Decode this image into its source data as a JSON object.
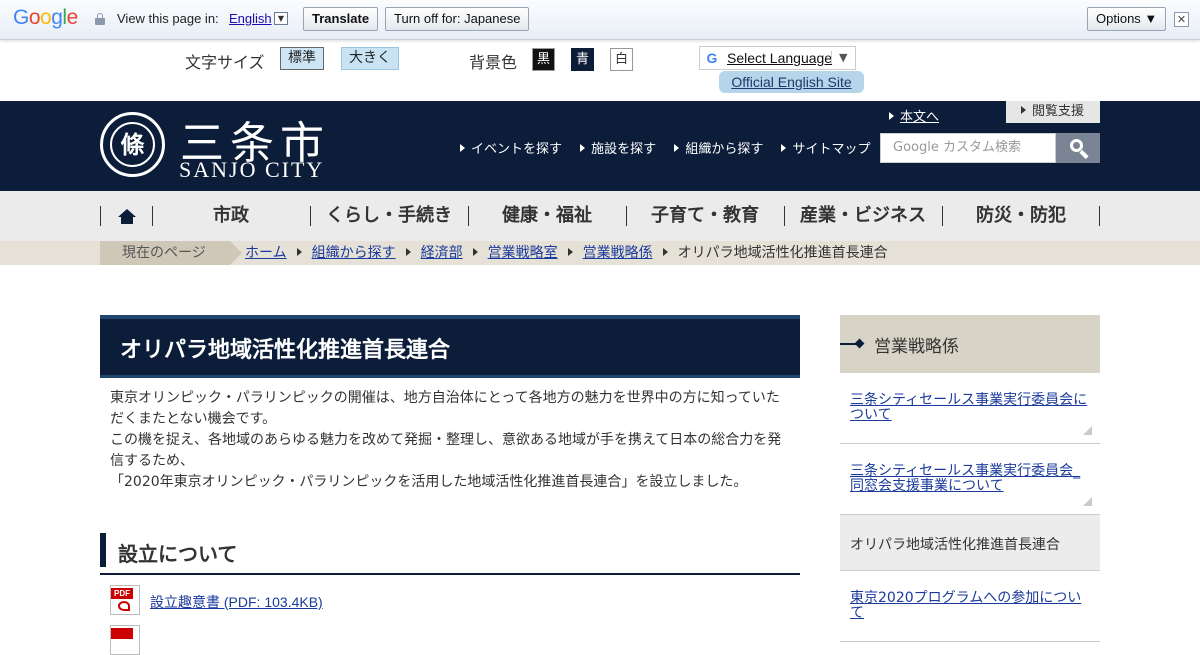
{
  "google_bar": {
    "logo_letters": [
      {
        "ch": "G",
        "color": "#4285f4"
      },
      {
        "ch": "o",
        "color": "#ea4335"
      },
      {
        "ch": "o",
        "color": "#fbbc05"
      },
      {
        "ch": "g",
        "color": "#4285f4"
      },
      {
        "ch": "l",
        "color": "#34a853"
      },
      {
        "ch": "e",
        "color": "#ea4335"
      }
    ],
    "view_text": "View this page in:",
    "language": "English",
    "translate_label": "Translate",
    "turn_off_label": "Turn off for: Japanese",
    "options_label": "Options ▼",
    "close_glyph": "✕"
  },
  "utility": {
    "font_size_label": "文字サイズ",
    "font_normal": "標準",
    "font_large": "大きく",
    "bg_label": "背景色",
    "bg_black": "黒",
    "bg_blue": "青",
    "bg_white": "白",
    "select_language": "Select Language",
    "select_arrow": "▼",
    "google_g": "G",
    "english_site": "Official English Site"
  },
  "header": {
    "emblem_glyph": "條",
    "city_jp": "三条市",
    "city_en": "SANJO CITY",
    "skip_link": "本文へ",
    "reading_support": "閲覧支援",
    "links": [
      "イベントを探す",
      "施設を探す",
      "組織から探す",
      "サイトマップ"
    ],
    "search_placeholder": "Google カスタム検索"
  },
  "nav": {
    "items": [
      "市政",
      "くらし・手続き",
      "健康・福祉",
      "子育て・教育",
      "産業・ビジネス",
      "防災・防犯"
    ]
  },
  "breadcrumb": {
    "current_label": "現在のページ",
    "items": [
      "ホーム",
      "組織から探す",
      "経済部",
      "営業戦略室",
      "営業戦略係"
    ],
    "current": "オリパラ地域活性化推進首長連合"
  },
  "main": {
    "title": "オリパラ地域活性化推進首長連合",
    "intro": [
      "東京オリンピック・パラリンピックの開催は、地方自治体にとって各地方の魅力を世界中の方に知っていただくまたとない機会です。",
      "この機を捉え、各地域のあらゆる魅力を改めて発掘・整理し、意欲ある地域が手を携えて日本の総合力を発信するため、",
      "「2020年東京オリンピック・パラリンピックを活用した地域活性化推進首長連合」を設立しました。"
    ],
    "section_title": "設立について",
    "pdf_label": "PDF",
    "files": [
      {
        "label": "設立趣意書 (PDF: 103.4KB)"
      }
    ]
  },
  "side": {
    "heading": "営業戦略係",
    "items": [
      {
        "label": "三条シティセールス事業実行委員会について",
        "current": false
      },
      {
        "label": "三条シティセールス事業実行委員会_同窓会支援事業について",
        "current": false
      },
      {
        "label": "オリパラ地域活性化推進首長連合",
        "current": true
      },
      {
        "label": "東京2020プログラムへの参加について",
        "current": false
      }
    ]
  }
}
